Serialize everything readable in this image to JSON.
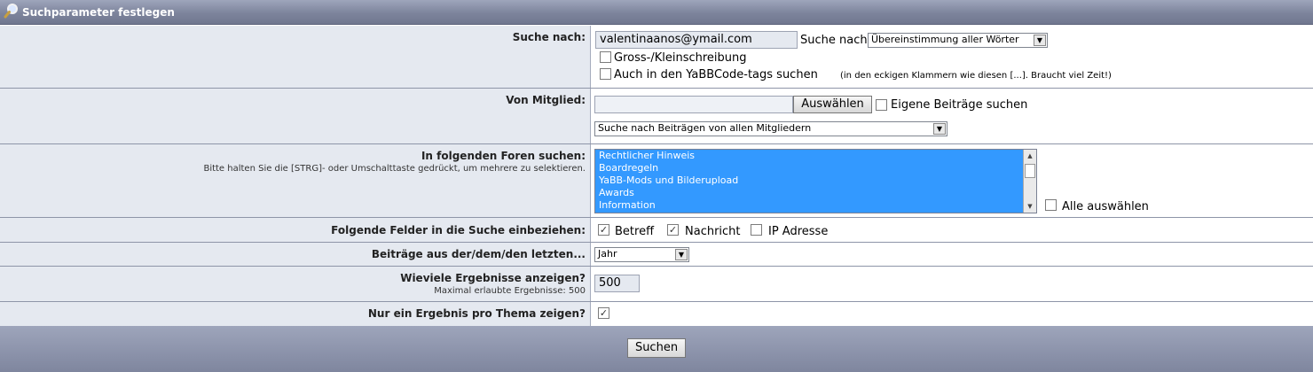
{
  "header": {
    "title": "Suchparameter festlegen"
  },
  "search_for": {
    "label": "Suche nach:",
    "input_value": "valentinaanos@ymail.com",
    "mode_label": "Suche nach",
    "mode_selected": "Übereinstimmung aller Wörter",
    "case_label": "Gross-/Kleinschreibung",
    "yabbcode_label": "Auch in den YaBBCode-tags suchen",
    "yabbcode_note": "(in den eckigen Klammern wie diesen [...]. Braucht viel Zeit!)"
  },
  "member": {
    "label": "Von Mitglied:",
    "input_value": "",
    "select_button": "Auswählen",
    "own_posts_label": "Eigene Beiträge suchen",
    "scope_selected": "Suche nach Beiträgen von allen Mitgliedern"
  },
  "forums": {
    "label": "In folgenden Foren suchen:",
    "hint": "Bitte halten Sie die [STRG]- oder Umschalttaste gedrückt, um mehrere zu selektieren.",
    "items": [
      "Rechtlicher Hinweis",
      "Boardregeln",
      "YaBB-Mods und Bilderupload",
      "Awards",
      "Information"
    ],
    "select_all_label": "Alle auswählen"
  },
  "fields": {
    "label": "Folgende Felder in die Suche einbeziehen:",
    "subject_label": "Betreff",
    "message_label": "Nachricht",
    "ip_label": "IP Adresse"
  },
  "timeframe": {
    "label": "Beiträge aus der/dem/den letzten...",
    "selected": "Jahr"
  },
  "results": {
    "label": "Wieviele Ergebnisse anzeigen?",
    "hint": "Maximal erlaubte Ergebnisse: 500",
    "value": "500"
  },
  "one_per_topic": {
    "label": "Nur ein Ergebnis pro Thema zeigen?"
  },
  "footer": {
    "submit_label": "Suchen"
  },
  "colors": {
    "selection": "#3399ff",
    "label_bg": "#e5e9f0",
    "bar": "#7d849c"
  }
}
